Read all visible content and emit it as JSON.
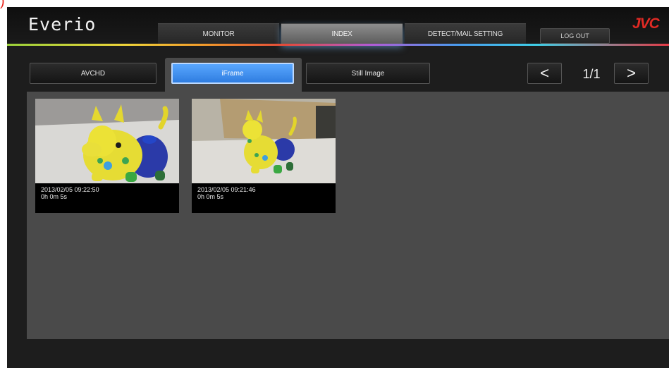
{
  "corner_mark": ")",
  "app": {
    "brand": "Everio",
    "logo": "JVC",
    "nav_tabs": [
      {
        "label": "MONITOR",
        "active": false
      },
      {
        "label": "INDEX",
        "active": true
      },
      {
        "label": "DETECT/MAIL SETTING",
        "active": false
      }
    ],
    "logout_label": "LOG OUT"
  },
  "sub_tabs": [
    {
      "label": "AVCHD",
      "active": false
    },
    {
      "label": "iFrame",
      "active": true
    },
    {
      "label": "Still Image",
      "active": false
    }
  ],
  "pager": {
    "prev_icon": "<",
    "next_icon": ">",
    "page": "1/1"
  },
  "thumbnails": [
    {
      "datetime": "2013/02/05 09:22:50",
      "duration": "0h 0m 5s"
    },
    {
      "datetime": "2013/02/05 09:21:46",
      "duration": "0h 0m 5s"
    }
  ],
  "colors": {
    "accent_blue": "#4a96f5",
    "logo_red": "#e12a24",
    "content_gray": "#4a4a4a"
  }
}
